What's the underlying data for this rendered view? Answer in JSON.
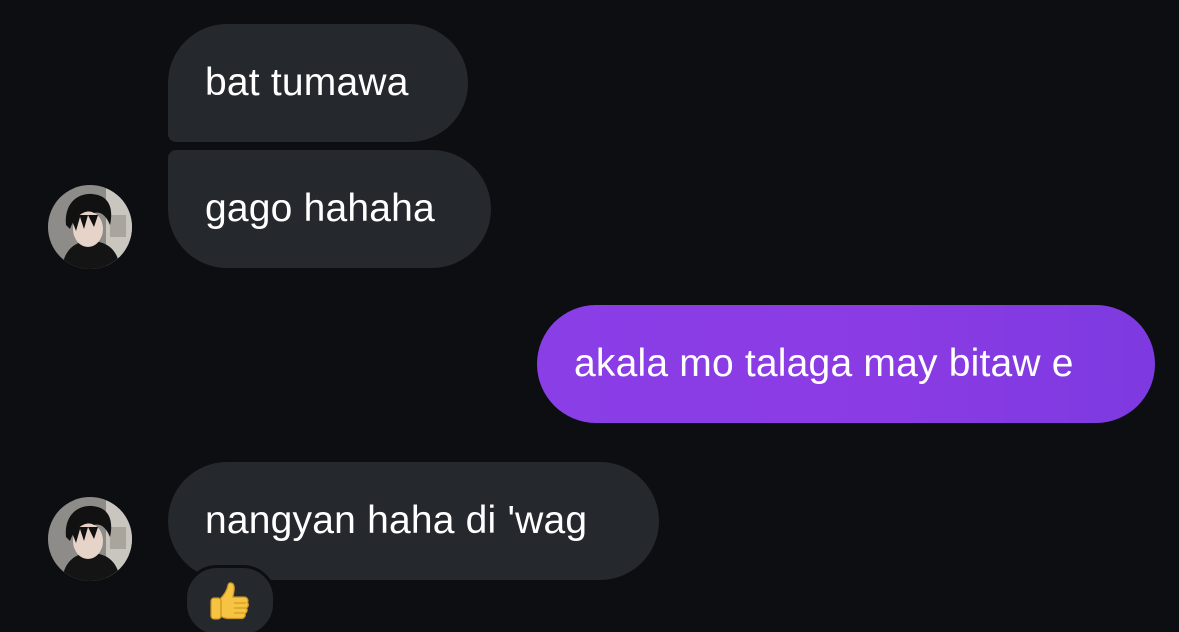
{
  "conversation": {
    "messages": [
      {
        "direction": "incoming",
        "text": "bat tumawa"
      },
      {
        "direction": "incoming",
        "text": "gago hahaha"
      },
      {
        "direction": "outgoing",
        "text": "akala mo talaga may bitaw e"
      },
      {
        "direction": "incoming",
        "text": "nangyan haha di 'wag",
        "reaction": "thumbs-up"
      }
    ]
  },
  "colors": {
    "background": "#0c0e12",
    "incoming_bubble": "#25282d",
    "outgoing_bubble": "#8a3ee6",
    "text": "#ffffff"
  },
  "icons": {
    "avatar": "profile-photo",
    "reaction": "thumbs-up-emoji"
  }
}
